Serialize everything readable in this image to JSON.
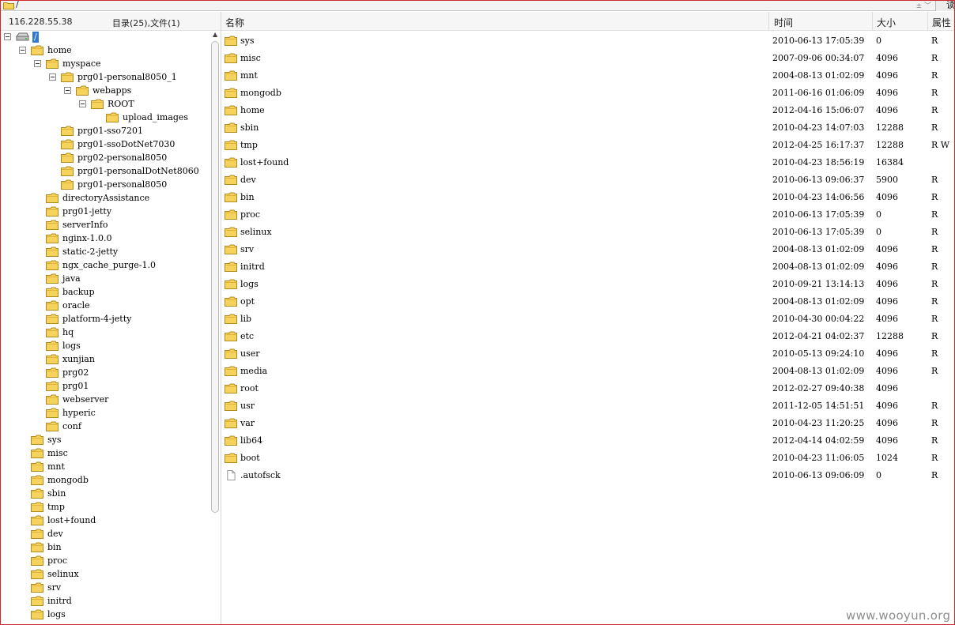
{
  "address": {
    "path": "/",
    "dropdown_glyph": "± ﹀",
    "go_label": "读"
  },
  "left_pane": {
    "server_ip": "116.228.55.38",
    "summary": "目录(25),文件(1)"
  },
  "tree": [
    {
      "label": "/",
      "depth": 0,
      "expanded": true,
      "drive": true,
      "selected": true
    },
    {
      "label": "home",
      "depth": 1,
      "expanded": true
    },
    {
      "label": "myspace",
      "depth": 2,
      "expanded": true
    },
    {
      "label": "prg01-personal8050_1",
      "depth": 3,
      "expanded": true
    },
    {
      "label": "webapps",
      "depth": 4,
      "expanded": true
    },
    {
      "label": "ROOT",
      "depth": 5,
      "expanded": true
    },
    {
      "label": "upload_images",
      "depth": 6
    },
    {
      "label": "prg01-sso7201",
      "depth": 3
    },
    {
      "label": "prg01-ssoDotNet7030",
      "depth": 3
    },
    {
      "label": "prg02-personal8050",
      "depth": 3
    },
    {
      "label": "prg01-personalDotNet8060",
      "depth": 3
    },
    {
      "label": "prg01-personal8050",
      "depth": 3
    },
    {
      "label": "directoryAssistance",
      "depth": 2
    },
    {
      "label": "prg01-jetty",
      "depth": 2
    },
    {
      "label": "serverInfo",
      "depth": 2
    },
    {
      "label": "nginx-1.0.0",
      "depth": 2
    },
    {
      "label": "static-2-jetty",
      "depth": 2
    },
    {
      "label": "ngx_cache_purge-1.0",
      "depth": 2
    },
    {
      "label": "java",
      "depth": 2
    },
    {
      "label": "backup",
      "depth": 2
    },
    {
      "label": "oracle",
      "depth": 2
    },
    {
      "label": "platform-4-jetty",
      "depth": 2
    },
    {
      "label": "hq",
      "depth": 2
    },
    {
      "label": "logs",
      "depth": 2
    },
    {
      "label": "xunjian",
      "depth": 2
    },
    {
      "label": "prg02",
      "depth": 2
    },
    {
      "label": "prg01",
      "depth": 2
    },
    {
      "label": "webserver",
      "depth": 2
    },
    {
      "label": "hyperic",
      "depth": 2
    },
    {
      "label": "conf",
      "depth": 2
    },
    {
      "label": "sys",
      "depth": 1
    },
    {
      "label": "misc",
      "depth": 1
    },
    {
      "label": "mnt",
      "depth": 1
    },
    {
      "label": "mongodb",
      "depth": 1
    },
    {
      "label": "sbin",
      "depth": 1
    },
    {
      "label": "tmp",
      "depth": 1
    },
    {
      "label": "lost+found",
      "depth": 1
    },
    {
      "label": "dev",
      "depth": 1
    },
    {
      "label": "bin",
      "depth": 1
    },
    {
      "label": "proc",
      "depth": 1
    },
    {
      "label": "selinux",
      "depth": 1
    },
    {
      "label": "srv",
      "depth": 1
    },
    {
      "label": "initrd",
      "depth": 1
    },
    {
      "label": "logs",
      "depth": 1
    }
  ],
  "columns": {
    "name": "名称",
    "time": "时间",
    "size": "大小",
    "attr": "属性"
  },
  "files": [
    {
      "name": "sys",
      "time": "2010-06-13 17:05:39",
      "size": "0",
      "attr": "R",
      "type": "folder"
    },
    {
      "name": "misc",
      "time": "2007-09-06 00:34:07",
      "size": "4096",
      "attr": "R",
      "type": "folder"
    },
    {
      "name": "mnt",
      "time": "2004-08-13 01:02:09",
      "size": "4096",
      "attr": "R",
      "type": "folder"
    },
    {
      "name": "mongodb",
      "time": "2011-06-16 01:06:09",
      "size": "4096",
      "attr": "R",
      "type": "folder"
    },
    {
      "name": "home",
      "time": "2012-04-16 15:06:07",
      "size": "4096",
      "attr": "R",
      "type": "folder"
    },
    {
      "name": "sbin",
      "time": "2010-04-23 14:07:03",
      "size": "12288",
      "attr": "R",
      "type": "folder"
    },
    {
      "name": "tmp",
      "time": "2012-04-25 16:17:37",
      "size": "12288",
      "attr": "R W",
      "type": "folder"
    },
    {
      "name": "lost+found",
      "time": "2010-04-23 18:56:19",
      "size": "16384",
      "attr": "",
      "type": "folder"
    },
    {
      "name": "dev",
      "time": "2010-06-13 09:06:37",
      "size": "5900",
      "attr": "R",
      "type": "folder"
    },
    {
      "name": "bin",
      "time": "2010-04-23 14:06:56",
      "size": "4096",
      "attr": "R",
      "type": "folder"
    },
    {
      "name": "proc",
      "time": "2010-06-13 17:05:39",
      "size": "0",
      "attr": "R",
      "type": "folder"
    },
    {
      "name": "selinux",
      "time": "2010-06-13 17:05:39",
      "size": "0",
      "attr": "R",
      "type": "folder"
    },
    {
      "name": "srv",
      "time": "2004-08-13 01:02:09",
      "size": "4096",
      "attr": "R",
      "type": "folder"
    },
    {
      "name": "initrd",
      "time": "2004-08-13 01:02:09",
      "size": "4096",
      "attr": "R",
      "type": "folder"
    },
    {
      "name": "logs",
      "time": "2010-09-21 13:14:13",
      "size": "4096",
      "attr": "R",
      "type": "folder"
    },
    {
      "name": "opt",
      "time": "2004-08-13 01:02:09",
      "size": "4096",
      "attr": "R",
      "type": "folder"
    },
    {
      "name": "lib",
      "time": "2010-04-30 00:04:22",
      "size": "4096",
      "attr": "R",
      "type": "folder"
    },
    {
      "name": "etc",
      "time": "2012-04-21 04:02:37",
      "size": "12288",
      "attr": "R",
      "type": "folder"
    },
    {
      "name": "user",
      "time": "2010-05-13 09:24:10",
      "size": "4096",
      "attr": "R",
      "type": "folder"
    },
    {
      "name": "media",
      "time": "2004-08-13 01:02:09",
      "size": "4096",
      "attr": "R",
      "type": "folder"
    },
    {
      "name": "root",
      "time": "2012-02-27 09:40:38",
      "size": "4096",
      "attr": "",
      "type": "folder"
    },
    {
      "name": "usr",
      "time": "2011-12-05 14:51:51",
      "size": "4096",
      "attr": "R",
      "type": "folder"
    },
    {
      "name": "var",
      "time": "2010-04-23 11:20:25",
      "size": "4096",
      "attr": "R",
      "type": "folder"
    },
    {
      "name": "lib64",
      "time": "2012-04-14 04:02:59",
      "size": "4096",
      "attr": "R",
      "type": "folder"
    },
    {
      "name": "boot",
      "time": "2010-04-23 11:06:05",
      "size": "1024",
      "attr": "R",
      "type": "folder"
    },
    {
      "name": ".autofsck",
      "time": "2010-06-13 09:06:09",
      "size": "0",
      "attr": "R",
      "type": "file"
    }
  ],
  "watermark": "www.wooyun.org",
  "colors": {
    "folder": "#f5d35c",
    "folder_edge": "#b08a1e",
    "selection": "#3178d4",
    "frame": "#cc2a2a"
  },
  "icons": {
    "folder": "folder-icon",
    "file": "file-icon",
    "drive": "drive-icon",
    "expander": "collapse-icon"
  }
}
